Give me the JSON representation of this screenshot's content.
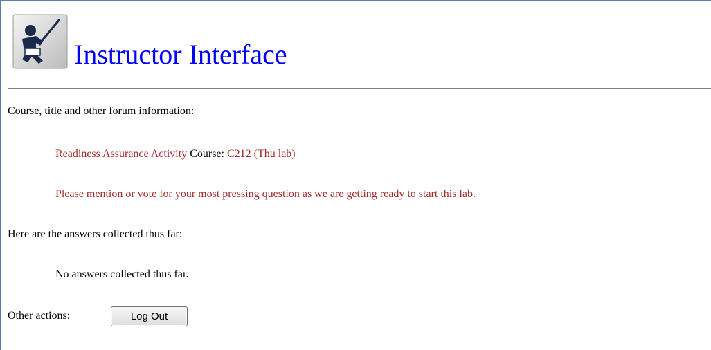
{
  "header": {
    "title": "Instructor Interface",
    "icon": "instructor-pointer-icon"
  },
  "forum_info": {
    "label": "Course, title and other forum information:",
    "activity_title": "Readiness Assurance Activity",
    "course_label": "Course:",
    "course_value": "C212 (Thu lab)",
    "prompt": "Please mention or vote for your most pressing question as we are getting ready to start this lab."
  },
  "answers": {
    "label": "Here are the answers collected thus far:",
    "empty_text": "No answers collected thus far."
  },
  "actions": {
    "label": "Other actions:",
    "logout_label": "Log Out"
  },
  "colors": {
    "title": "#0000ff",
    "highlight": "#a52a2a",
    "frame_border": "#5a7eae"
  }
}
